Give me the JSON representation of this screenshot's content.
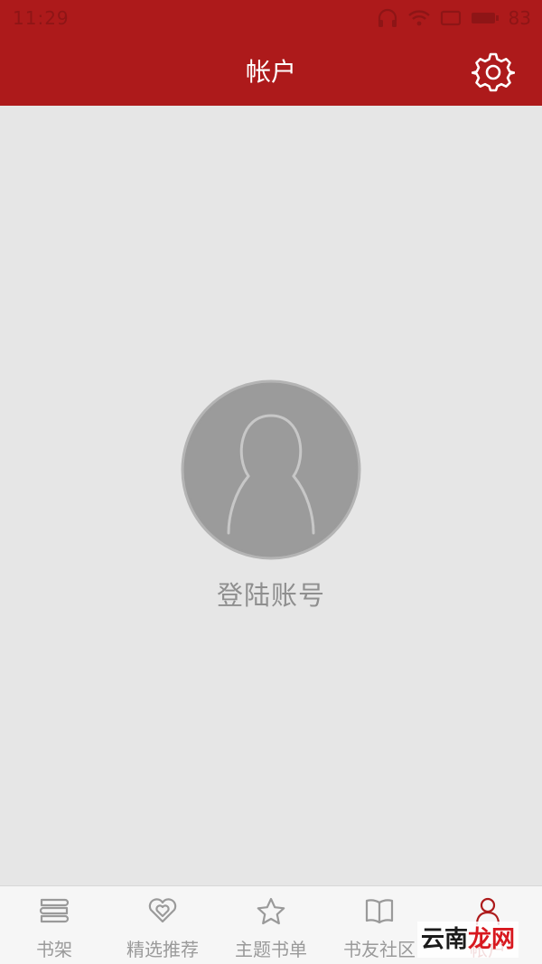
{
  "status_bar": {
    "time": "11:29",
    "battery": "83"
  },
  "header": {
    "title": "帐户"
  },
  "account": {
    "login_label": "登陆账号"
  },
  "tabs": [
    {
      "label": "书架",
      "icon": "bookshelf-icon"
    },
    {
      "label": "精选推荐",
      "icon": "heart-icon"
    },
    {
      "label": "主题书单",
      "icon": "star-icon"
    },
    {
      "label": "书友社区",
      "icon": "open-book-icon"
    },
    {
      "label": "帐户",
      "icon": "person-icon"
    }
  ],
  "watermark": {
    "part_a": "云南",
    "part_b": "龙网"
  },
  "colors": {
    "primary": "#ad1a1b",
    "background": "#e6e6e6",
    "tab_inactive": "#9a9a9a"
  }
}
